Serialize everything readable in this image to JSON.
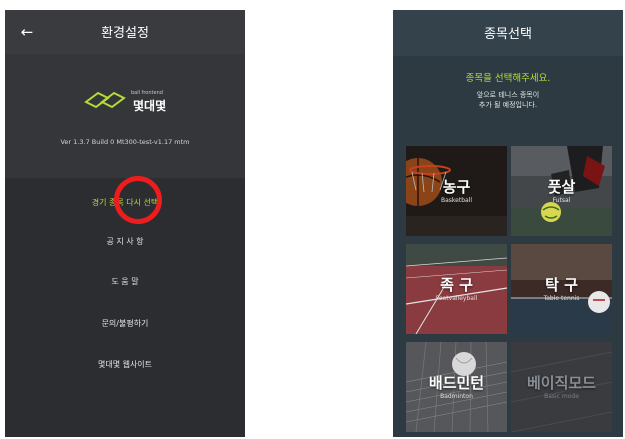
{
  "settings_screen": {
    "title": "환경설정",
    "back_icon": "arrow-left-icon",
    "logo": {
      "small_text": "ball frontend",
      "name": "몇대몇"
    },
    "version": "Ver  1.3.7 Build 0 Mt300-test-v1.17 mtm",
    "menu": [
      {
        "label": "경기 종목 다시 선택"
      },
      {
        "label": "공 지 사 항"
      },
      {
        "label": "도 움 말"
      },
      {
        "label": "문의/불평하기"
      },
      {
        "label": "몇대몇 웹사이트"
      }
    ]
  },
  "sport_select_screen": {
    "title": "종목선택",
    "prompt": "종목을 선택해주세요.",
    "notice_line1": "앞으로 테니스 종목이",
    "notice_line2": "추가 될 예정입니다.",
    "tiles": [
      {
        "name": "농구",
        "sub": "Basketball"
      },
      {
        "name": "풋살",
        "sub": "Futsal"
      },
      {
        "name": "족 구",
        "sub": "Footvalleyball"
      },
      {
        "name": "탁 구",
        "sub": "Table tennis"
      },
      {
        "name": "배드민턴",
        "sub": "Badminton"
      },
      {
        "name": "베이직모드",
        "sub": "Basic mode"
      }
    ]
  },
  "colors": {
    "accent": "#b5dd38",
    "highlight_ring": "#ee1c1c",
    "left_bg": "#2c2d31",
    "right_bg": "#2d3a42"
  }
}
